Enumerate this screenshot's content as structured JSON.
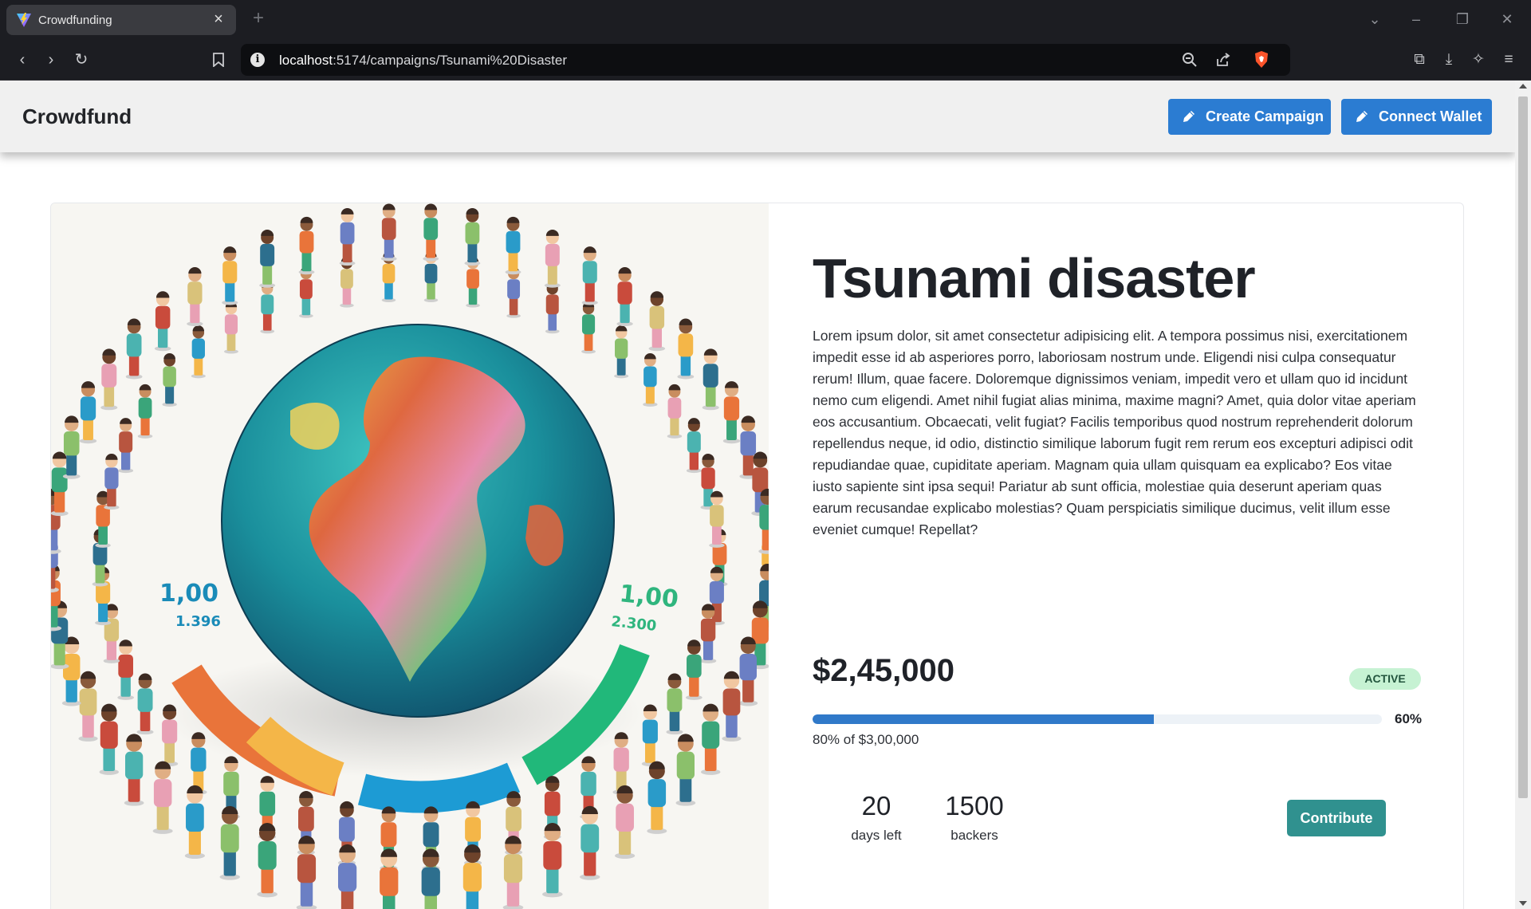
{
  "browser": {
    "tab_title": "Crowdfunding",
    "url_host": "localhost",
    "url_path": ":5174/campaigns/Tsunami%20Disaster"
  },
  "navbar": {
    "brand": "Crowdfund",
    "create_label": "Create Campaign",
    "connect_label": "Connect Wallet"
  },
  "campaign": {
    "title": "Tsunami disaster",
    "description": "Lorem ipsum dolor, sit amet consectetur adipisicing elit. A tempora possimus nisi, exercitationem impedit esse id ab asperiores porro, laboriosam nostrum unde. Eligendi nisi culpa consequatur rerum! Illum, quae facere. Doloremque dignissimos veniam, impedit vero et ullam quo id incidunt nemo cum eligendi. Amet nihil fugiat alias minima, maxime magni? Amet, quia dolor vitae aperiam eos accusantium. Obcaecati, velit fugiat? Facilis temporibus quod nostrum reprehenderit dolorum repellendus neque, id odio, distinctio similique laborum fugit rem rerum eos excepturi adipisci odit repudiandae quae, cupiditate aperiam. Magnam quia ullam quisquam ea explicabo? Eos vitae iusto sapiente sint ipsa sequi! Pariatur ab sunt officia, molestiae quia deserunt aperiam quas earum recusandae explicabo molestias? Quam perspiciatis similique ducimus, velit illum esse eveniet cumque! Repellat?",
    "raised": "$2,45,000",
    "status": "ACTIVE",
    "progress_fraction": 0.6,
    "progress_label": "60%",
    "goal_text": "80% of $3,00,000",
    "days_left": "20",
    "days_left_label": "days left",
    "backers": "1500",
    "backers_label": "backers",
    "contribute_label": "Contribute"
  },
  "hero_image": {
    "left_number": "1,00",
    "left_sub": "1.396",
    "right_number": "1,00",
    "right_sub": "2.300"
  },
  "colors": {
    "primary": "#2b7cd2",
    "contribute": "#30918f",
    "badge_bg": "#c6f2d3",
    "progress_fill": "#3079c9"
  }
}
